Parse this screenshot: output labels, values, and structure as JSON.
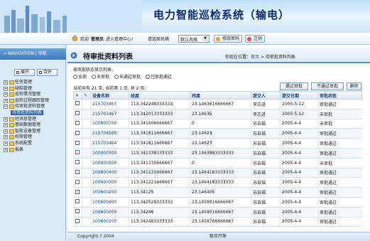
{
  "app": {
    "title": "电力智能巡检系统（输电）"
  },
  "userbar": {
    "welcome": "欢迎",
    "user": "管理员",
    "enter": "进入管理中心!",
    "style_label": "请选择风格",
    "style_value": "默认风格",
    "change_password": "修改密码",
    "logout": "注销"
  },
  "sidebar": {
    "nav_title": "NAVIGATION | 导航",
    "expand_all": "展开",
    "collapse_all": "合并",
    "items": [
      "任务管理",
      "缺陷管理",
      "巡检情况管理",
      "巡检过程跟踪管理",
      "待审批资料管理",
      "待审批资料列表",
      "短消息管理",
      "基础数据管理",
      "智能设备管理",
      "权限管理",
      "系统配置",
      "报表"
    ]
  },
  "main": {
    "page_title": "待审批资料列表",
    "crumb_prefix": "你现在位置：",
    "crumb_home": "首页",
    "crumb_current": "> 待审批资料列表",
    "filter_label": "按审批状态显示列表:",
    "filters": [
      "全部",
      "未审批",
      "未通过审批",
      "已审批通过"
    ],
    "pager_text": "当前共有 21 条, 当前第 1 页, 共 2 页.",
    "btn_approve": "通过审批",
    "btn_reject": "不通过审批",
    "btn_delete": "删除"
  },
  "table": {
    "columns": [
      "设备名称",
      "经度",
      "纬度",
      "提交人",
      "提交日期",
      "审批状态"
    ],
    "rows": [
      [
        "215703467",
        "113.342248333333",
        "23.1463616666667",
        "李志进",
        "2005-5-12",
        "审批通过"
      ],
      [
        "215703467",
        "113.342013333333",
        "23.14635",
        "李志进",
        "2005-5-12",
        "未审批"
      ],
      [
        "100600700",
        "113.341606666667",
        "0",
        "苏自福",
        "2005-4-4",
        "未审批"
      ],
      [
        "215704585",
        "113.341811666667",
        "23.14623",
        "苏自福",
        "2005-4-4",
        "审批通过"
      ],
      [
        "215703464",
        "113.341811666667",
        "23.14623",
        "苏自福",
        "2005-4-4",
        "审批通过"
      ],
      [
        "100900300",
        "113.341338333333",
        "23.1463883333333",
        "苏自福",
        "2005-4-4",
        "审批通过"
      ],
      [
        "100900500",
        "113.341335666667",
        "0",
        "苏自福",
        "2005-4-4",
        "未审批"
      ],
      [
        "100600400",
        "113.341221666667",
        "23.1464183333333",
        "苏自福",
        "2005-4-4",
        "审批通过"
      ],
      [
        "100600300",
        "113.341221666667",
        "23.1464183333333",
        "苏自福",
        "2005-4-4",
        "审批通过"
      ],
      [
        "100600200",
        "113.34125",
        "23.146405",
        "苏自福",
        "2005-4-4",
        "审批通过"
      ],
      [
        "100600400",
        "113.342528333333",
        "23.1458916666667",
        "苏自福",
        "2005-4-4",
        "审批通过"
      ],
      [
        "100600300",
        "113.34246",
        "23.1458916666667",
        "苏自福",
        "2005-4-4",
        "审批通过"
      ],
      [
        "100600200",
        "113.342483333333",
        "23.1458766666667",
        "苏自福",
        "2005-4-4",
        "审批通过"
      ]
    ]
  },
  "footer": {
    "copyright": "Copyright ? 2004",
    "developer": "联合开发"
  },
  "colors": {
    "accent": "#2e63a8",
    "title": "#0a2c6e",
    "link": "#1a4fa0"
  }
}
